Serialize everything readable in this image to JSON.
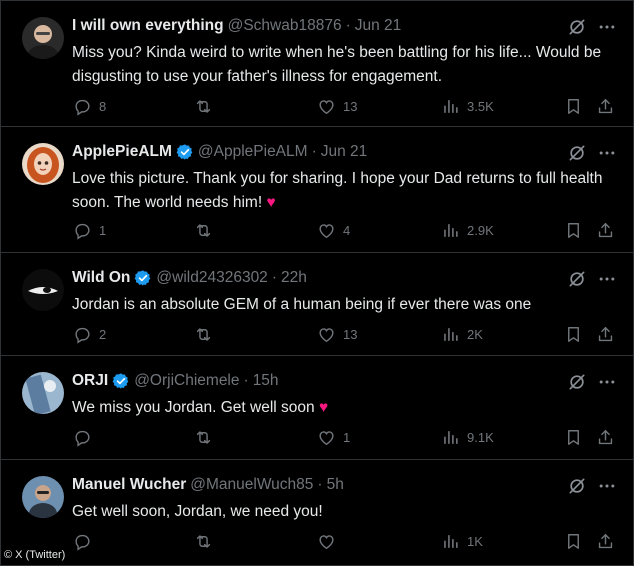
{
  "caption": "© X (Twitter)",
  "tweets": [
    {
      "name": "I will own everything",
      "verified": false,
      "handle": "@Schwab18876",
      "time": "Jun 21",
      "text": "Miss you? Kinda weird to write when he's been battling for his life... Would be disgusting to use your father's illness for engagement.",
      "heart_emoji": "",
      "replies": "8",
      "retweets": "",
      "likes": "13",
      "views": "3.5K",
      "avatar_color": "#3a3a3a"
    },
    {
      "name": "ApplePieALM",
      "verified": true,
      "handle": "@ApplePieALM",
      "time": "Jun 21",
      "text": "Love this picture. Thank you for sharing. I hope your Dad returns to full health soon. The world needs him!",
      "heart_emoji": "♥",
      "replies": "1",
      "retweets": "",
      "likes": "4",
      "views": "2.9K",
      "avatar_color": "#c65a2e"
    },
    {
      "name": "Wild On",
      "verified": true,
      "handle": "@wild24326302",
      "time": "22h",
      "text": "Jordan is an absolute GEM of a human being if ever there was one",
      "heart_emoji": "",
      "replies": "2",
      "retweets": "",
      "likes": "13",
      "views": "2K",
      "avatar_color": "#111111"
    },
    {
      "name": "ORJI",
      "verified": true,
      "handle": "@OrjiChiemele",
      "time": "15h",
      "text": "We miss you Jordan. Get well soon",
      "heart_emoji": "♥",
      "replies": "",
      "retweets": "",
      "likes": "1",
      "views": "9.1K",
      "avatar_color": "#6b8fb3"
    },
    {
      "name": "Manuel Wucher",
      "verified": false,
      "handle": "@ManuelWuch85",
      "time": "5h",
      "text": "Get well soon, Jordan, we need you!",
      "heart_emoji": "",
      "replies": "",
      "retweets": "",
      "likes": "",
      "views": "1K",
      "avatar_color": "#4d6a8a"
    }
  ],
  "colors": {
    "background": "#000000",
    "text": "#e7e9ea",
    "muted": "#71767b",
    "divider": "#2f3336",
    "verified": "#1d9bf0",
    "heart": "#f91880"
  },
  "icons": [
    "reply-icon",
    "retweet-icon",
    "like-icon",
    "views-icon",
    "bookmark-icon",
    "share-icon",
    "grok-icon",
    "more-icon",
    "verified-badge-icon"
  ]
}
